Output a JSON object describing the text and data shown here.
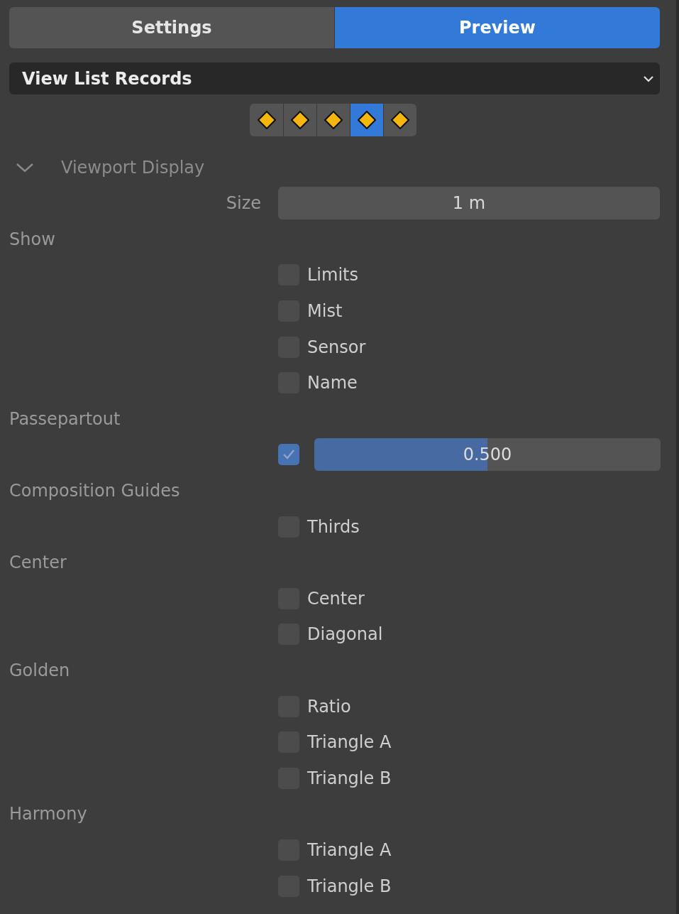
{
  "tabs": [
    {
      "label": "Settings",
      "selected": false
    },
    {
      "label": "Preview",
      "selected": true
    }
  ],
  "dropdown": {
    "value": "View List Records"
  },
  "keyframe_buttons": [
    {
      "selected": false
    },
    {
      "selected": false
    },
    {
      "selected": false
    },
    {
      "selected": true
    },
    {
      "selected": false
    }
  ],
  "section": {
    "title": "Viewport Display",
    "expanded": true
  },
  "size": {
    "label": "Size",
    "value": "1 m"
  },
  "rows": [
    {
      "kind": "heading",
      "label": "Show"
    },
    {
      "kind": "checkbox",
      "label": "Limits",
      "checked": false
    },
    {
      "kind": "checkbox",
      "label": "Mist",
      "checked": false
    },
    {
      "kind": "checkbox",
      "label": "Sensor",
      "checked": false
    },
    {
      "kind": "checkbox",
      "label": "Name",
      "checked": false
    },
    {
      "kind": "heading",
      "label": "Passepartout"
    },
    {
      "kind": "slider",
      "checked": true,
      "level": 0.5,
      "reading": "0.500"
    },
    {
      "kind": "heading",
      "label": "Composition Guides"
    },
    {
      "kind": "checkbox",
      "label": "Thirds",
      "checked": false
    },
    {
      "kind": "heading",
      "label": "Center"
    },
    {
      "kind": "checkbox",
      "label": "Center",
      "checked": false
    },
    {
      "kind": "checkbox",
      "label": "Diagonal",
      "checked": false
    },
    {
      "kind": "heading",
      "label": "Golden"
    },
    {
      "kind": "checkbox",
      "label": "Ratio",
      "checked": false
    },
    {
      "kind": "checkbox",
      "label": "Triangle A",
      "checked": false
    },
    {
      "kind": "checkbox",
      "label": "Triangle B",
      "checked": false
    },
    {
      "kind": "heading",
      "label": "Harmony"
    },
    {
      "kind": "checkbox",
      "label": "Triangle A",
      "checked": false
    },
    {
      "kind": "checkbox",
      "label": "Triangle B",
      "checked": false
    }
  ]
}
